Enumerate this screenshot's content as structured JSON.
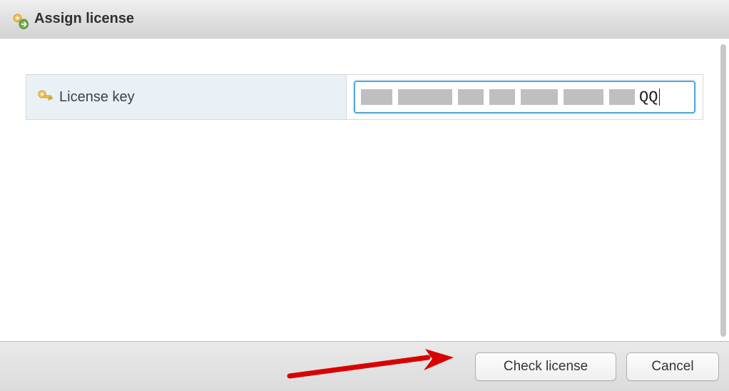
{
  "header": {
    "title": "Assign license"
  },
  "form": {
    "license_key_label": "License key",
    "input_visible_suffix": "QQ"
  },
  "footer": {
    "check_label": "Check license",
    "cancel_label": "Cancel"
  }
}
